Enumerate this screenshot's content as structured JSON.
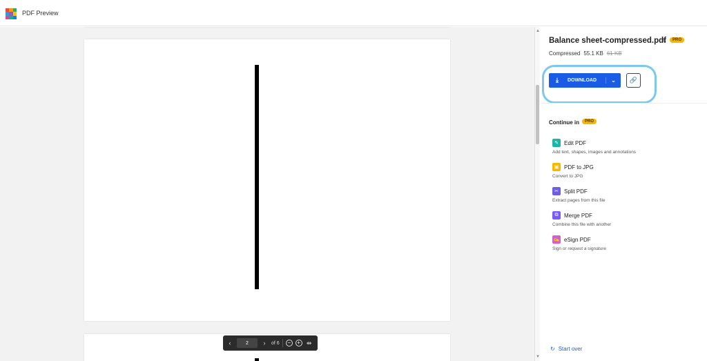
{
  "app": {
    "title": "PDF Preview",
    "logo_colors": [
      "#e74c3c",
      "#f39c12",
      "#27ae60",
      "#3498db",
      "#9b59b6",
      "#f1c40f",
      "#e84393",
      "#00b894",
      "#0984e3"
    ]
  },
  "viewer": {
    "current_page": "2",
    "page_total_label": "of 6",
    "icons": [
      "chevron-left-icon",
      "chevron-right-icon",
      "zoom-out-icon",
      "zoom-in-icon",
      "fit-width-icon"
    ]
  },
  "panel": {
    "file_name": "Balance sheet-compressed.pdf",
    "pro_badge": "PRO",
    "compressed_label": "Compressed",
    "new_size": "55.1 KB",
    "old_size": "61 KB",
    "download_label": "DOWNLOAD",
    "continue_label": "Continue in",
    "start_over": "Start over",
    "accent_color": "#1a5ce5",
    "highlight_color": "#7cc7f0",
    "tools": [
      {
        "name": "Edit PDF",
        "desc": "Add text, shapes, images and annotations",
        "color": "#1fb5a6",
        "icon": "edit-icon"
      },
      {
        "name": "PDF to JPG",
        "desc": "Convert to JPG",
        "color": "#f5b700",
        "icon": "image-icon"
      },
      {
        "name": "Split PDF",
        "desc": "Extract pages from this file",
        "color": "#6c5ce7",
        "icon": "scissors-icon"
      },
      {
        "name": "Merge PDF",
        "desc": "Combine this file with another",
        "color": "#7a5af8",
        "icon": "merge-icon"
      },
      {
        "name": "eSign PDF",
        "desc": "Sign or request a signature",
        "color": "#d85bd6",
        "icon": "signature-icon"
      }
    ]
  }
}
